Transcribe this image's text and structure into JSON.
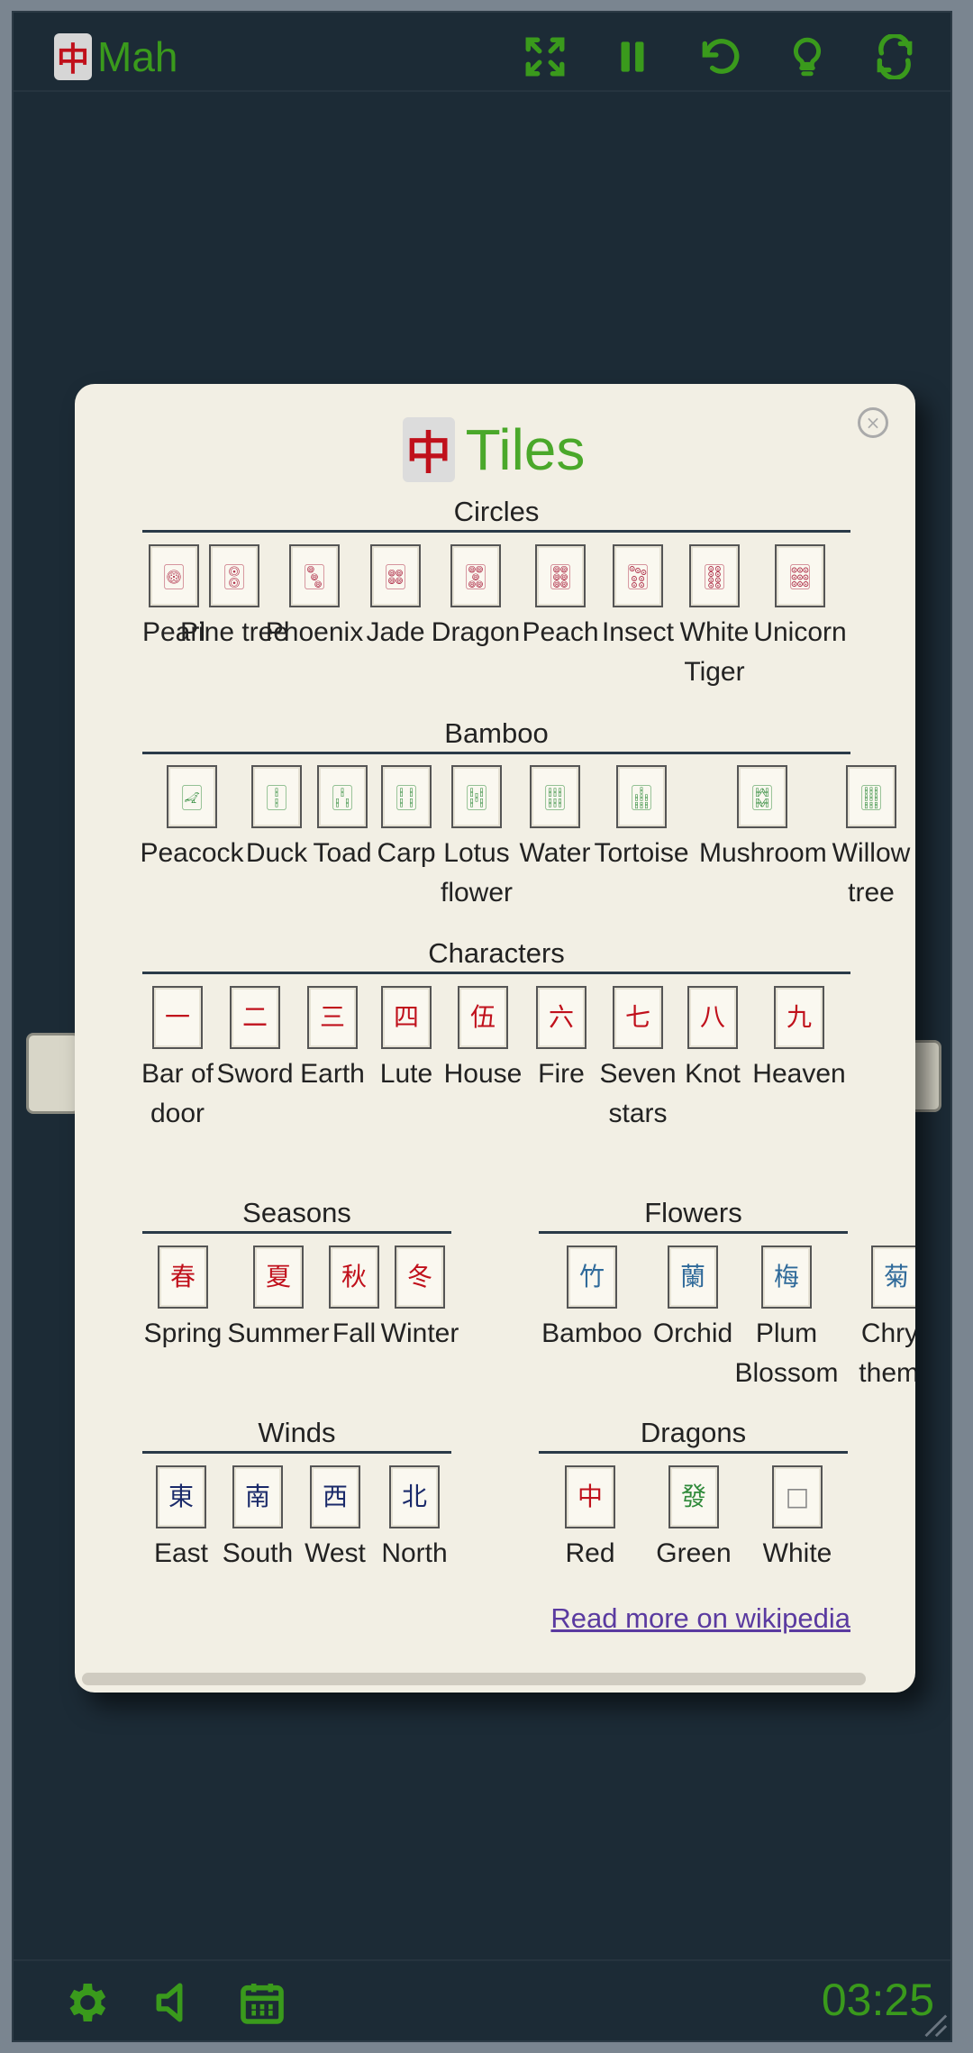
{
  "app": {
    "logo_glyph": "中",
    "title": "Mah",
    "timer": "03:25",
    "accent": "#3a9a1c",
    "background": "#1c2b36",
    "toolbar_icons": [
      "fullscreen-icon",
      "pause-icon",
      "undo-icon",
      "hint-bulb-icon",
      "shuffle-icon"
    ],
    "bottom_icons": [
      "gear-icon",
      "sound-icon",
      "calendar-icon"
    ]
  },
  "dialog": {
    "title_glyph": "中",
    "title": "Tiles",
    "close_label": "×",
    "wiki_link": "Read more on wikipedia",
    "sections": {
      "circles": {
        "title": "Circles",
        "tiles": [
          {
            "label": "Pearl",
            "glyph": "🀙"
          },
          {
            "label": "Pine tree",
            "glyph": "🀚"
          },
          {
            "label": "Phoenix",
            "glyph": "🀛"
          },
          {
            "label": "Jade",
            "glyph": "🀜"
          },
          {
            "label": "Dragon",
            "glyph": "🀝"
          },
          {
            "label": "Peach",
            "glyph": "🀞"
          },
          {
            "label": "Insect",
            "glyph": "🀟"
          },
          {
            "label": "White Tiger",
            "glyph": "🀠"
          },
          {
            "label": "Unicorn",
            "glyph": "🀡"
          }
        ]
      },
      "bamboo": {
        "title": "Bamboo",
        "tiles": [
          {
            "label": "Peacock",
            "glyph": "🀐"
          },
          {
            "label": "Duck",
            "glyph": "🀑"
          },
          {
            "label": "Toad",
            "glyph": "🀒"
          },
          {
            "label": "Carp",
            "glyph": "🀓"
          },
          {
            "label": "Lotus flower",
            "glyph": "🀔"
          },
          {
            "label": "Water",
            "glyph": "🀕"
          },
          {
            "label": "Tortoise",
            "glyph": "🀖"
          },
          {
            "label": "Mushroom",
            "glyph": "🀗"
          },
          {
            "label": "Willow tree",
            "glyph": "🀘"
          }
        ]
      },
      "characters": {
        "title": "Characters",
        "tiles": [
          {
            "label": "Bar of door",
            "glyph": "一"
          },
          {
            "label": "Sword",
            "glyph": "二"
          },
          {
            "label": "Earth",
            "glyph": "三"
          },
          {
            "label": "Lute",
            "glyph": "四"
          },
          {
            "label": "House",
            "glyph": "伍"
          },
          {
            "label": "Fire",
            "glyph": "六"
          },
          {
            "label": "Seven stars",
            "glyph": "七"
          },
          {
            "label": "Knot",
            "glyph": "八"
          },
          {
            "label": "Heaven",
            "glyph": "九"
          }
        ]
      },
      "seasons": {
        "title": "Seasons",
        "tiles": [
          {
            "label": "Spring",
            "glyph": "春"
          },
          {
            "label": "Summer",
            "glyph": "夏"
          },
          {
            "label": "Fall",
            "glyph": "秋"
          },
          {
            "label": "Winter",
            "glyph": "冬"
          }
        ]
      },
      "flowers": {
        "title": "Flowers",
        "tiles": [
          {
            "label": "Bamboo",
            "glyph": "竹"
          },
          {
            "label": "Orchid",
            "glyph": "蘭"
          },
          {
            "label": "Plum Blossom",
            "glyph": "梅"
          },
          {
            "label": "Chrys themu",
            "glyph": "菊"
          }
        ]
      },
      "winds": {
        "title": "Winds",
        "tiles": [
          {
            "label": "East",
            "glyph": "東"
          },
          {
            "label": "South",
            "glyph": "南"
          },
          {
            "label": "West",
            "glyph": "西"
          },
          {
            "label": "North",
            "glyph": "北"
          }
        ]
      },
      "dragons": {
        "title": "Dragons",
        "tiles": [
          {
            "label": "Red",
            "glyph": "中"
          },
          {
            "label": "Green",
            "glyph": "發"
          },
          {
            "label": "White",
            "glyph": "□"
          }
        ]
      }
    }
  }
}
